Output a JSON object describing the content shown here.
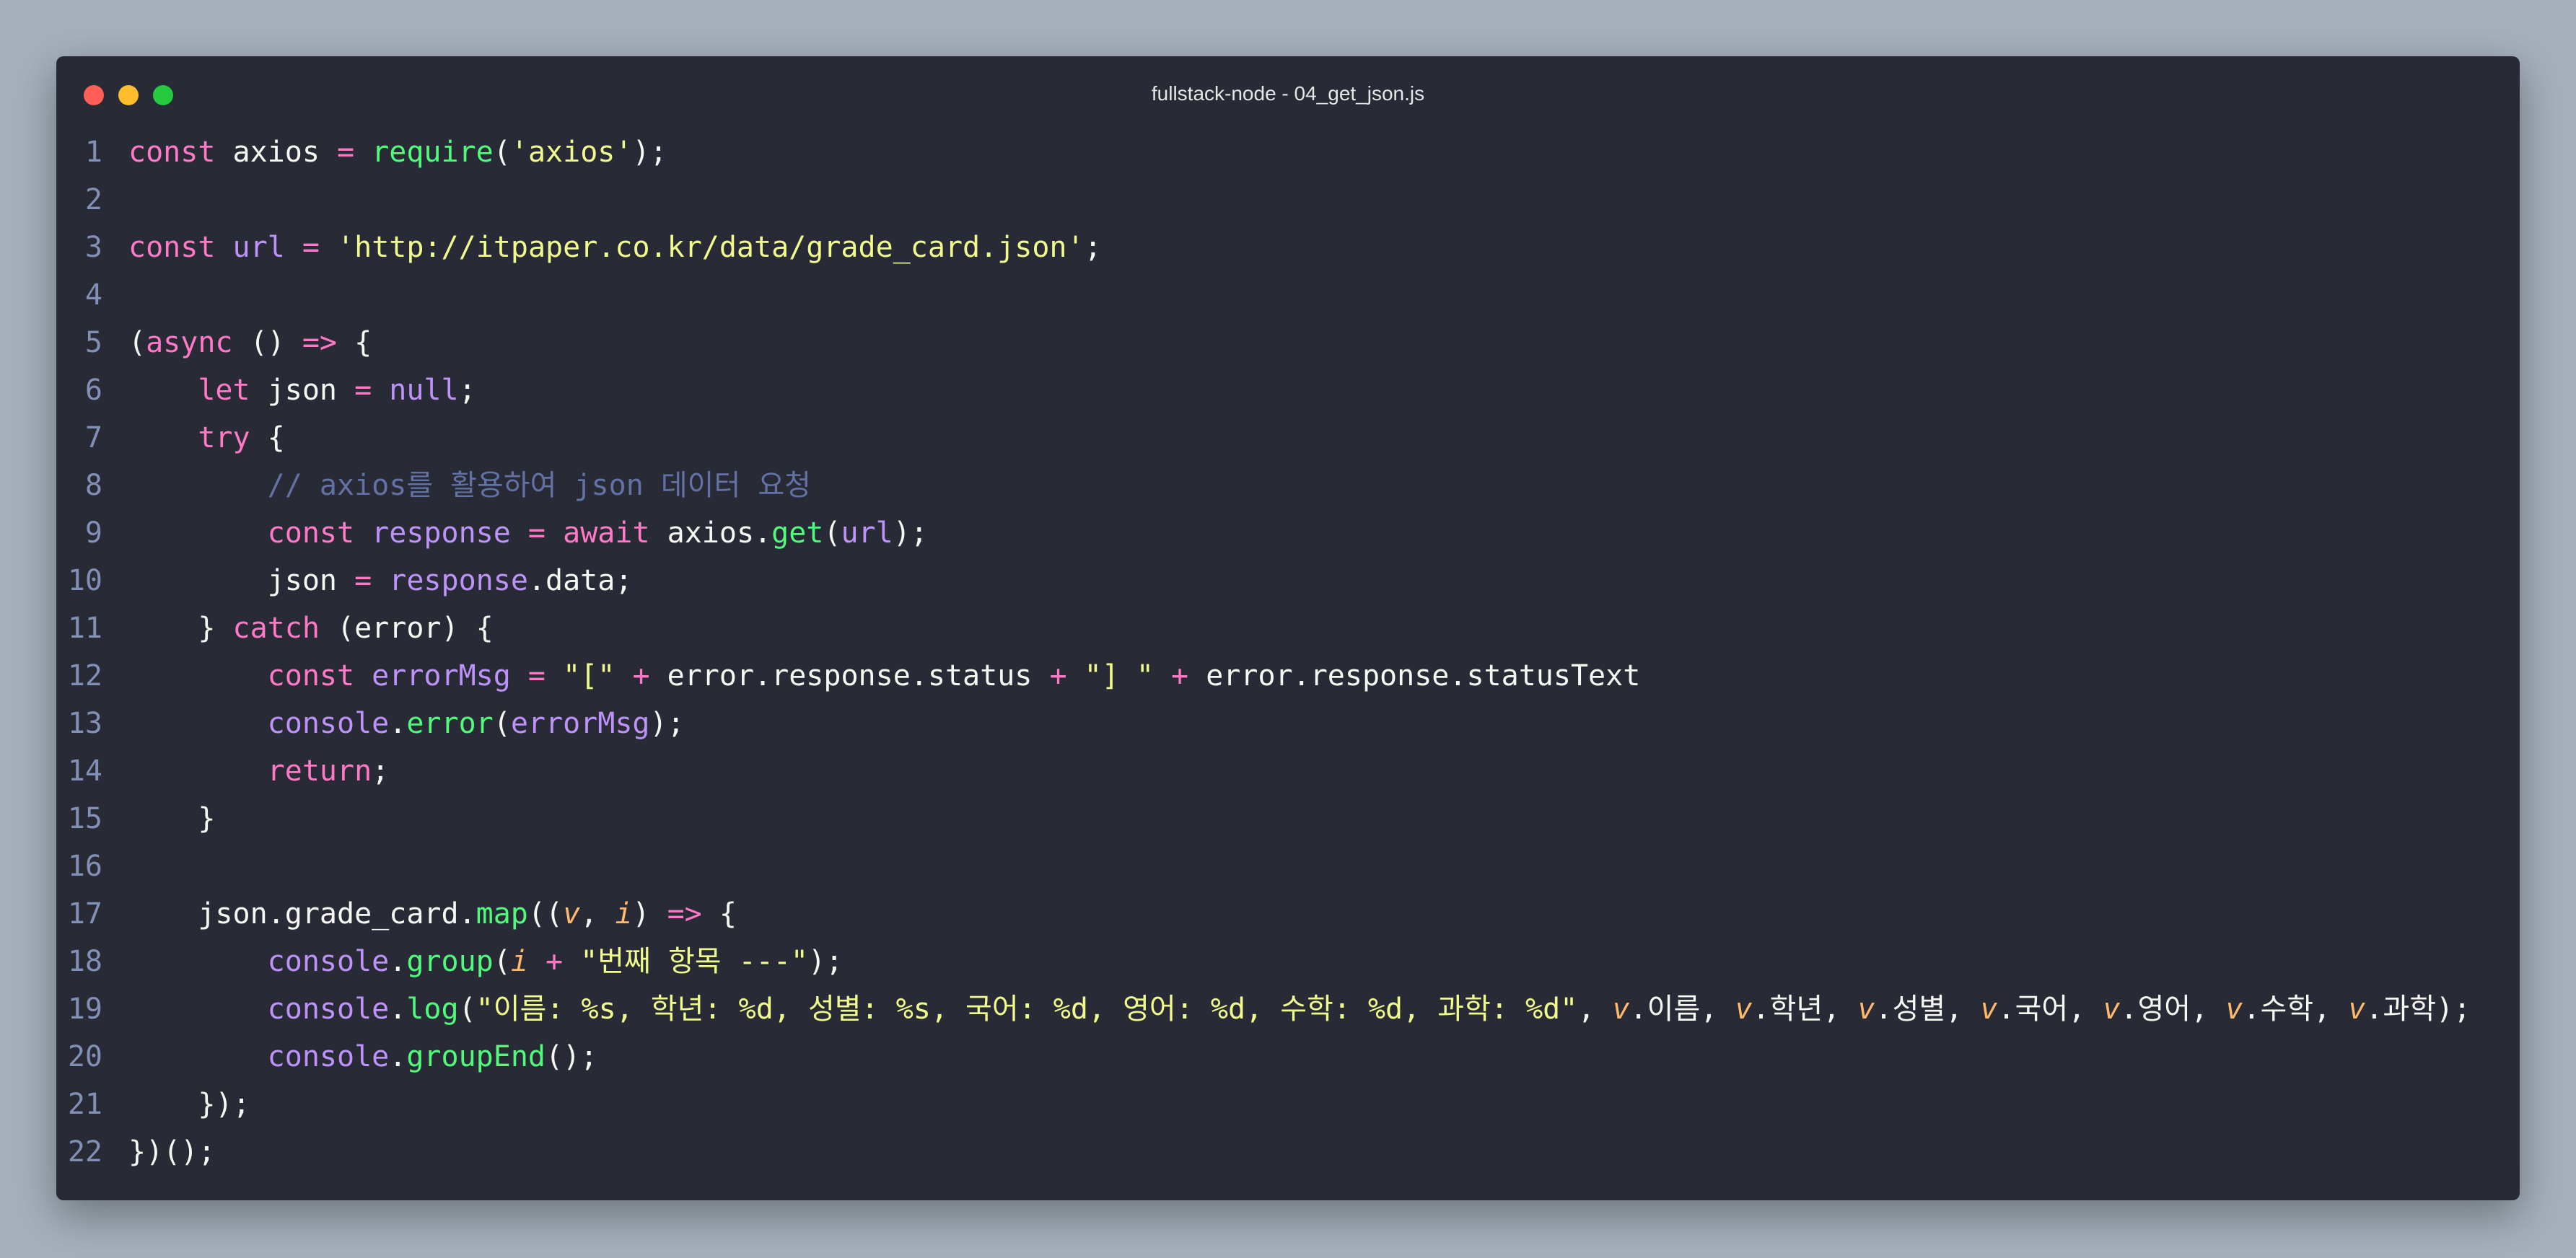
{
  "window": {
    "title": "fullstack-node - 04_get_json.js"
  },
  "lines": [
    {
      "n": "1",
      "tokens": [
        {
          "t": "const",
          "c": "k"
        },
        {
          "t": " axios ",
          "c": "p"
        },
        {
          "t": "=",
          "c": "k"
        },
        {
          "t": " ",
          "c": "p"
        },
        {
          "t": "require",
          "c": "f"
        },
        {
          "t": "(",
          "c": "p"
        },
        {
          "t": "'axios'",
          "c": "s"
        },
        {
          "t": ");",
          "c": "p"
        }
      ]
    },
    {
      "n": "2",
      "tokens": []
    },
    {
      "n": "3",
      "tokens": [
        {
          "t": "const",
          "c": "k"
        },
        {
          "t": " ",
          "c": "p"
        },
        {
          "t": "url",
          "c": "d"
        },
        {
          "t": " ",
          "c": "p"
        },
        {
          "t": "=",
          "c": "k"
        },
        {
          "t": " ",
          "c": "p"
        },
        {
          "t": "'http://itpaper.co.kr/data/grade_card.json'",
          "c": "s"
        },
        {
          "t": ";",
          "c": "p"
        }
      ]
    },
    {
      "n": "4",
      "tokens": []
    },
    {
      "n": "5",
      "tokens": [
        {
          "t": "(",
          "c": "p"
        },
        {
          "t": "async",
          "c": "k"
        },
        {
          "t": " () ",
          "c": "p"
        },
        {
          "t": "=>",
          "c": "k"
        },
        {
          "t": " {",
          "c": "p"
        }
      ]
    },
    {
      "n": "6",
      "tokens": [
        {
          "t": "    ",
          "c": "p"
        },
        {
          "t": "let",
          "c": "k"
        },
        {
          "t": " json ",
          "c": "p"
        },
        {
          "t": "=",
          "c": "k"
        },
        {
          "t": " ",
          "c": "p"
        },
        {
          "t": "null",
          "c": "d"
        },
        {
          "t": ";",
          "c": "p"
        }
      ]
    },
    {
      "n": "7",
      "tokens": [
        {
          "t": "    ",
          "c": "p"
        },
        {
          "t": "try",
          "c": "k"
        },
        {
          "t": " {",
          "c": "p"
        }
      ]
    },
    {
      "n": "8",
      "tokens": [
        {
          "t": "        ",
          "c": "p"
        },
        {
          "t": "// axios를 활용하여 json 데이터 요청",
          "c": "c"
        }
      ]
    },
    {
      "n": "9",
      "tokens": [
        {
          "t": "        ",
          "c": "p"
        },
        {
          "t": "const",
          "c": "k"
        },
        {
          "t": " ",
          "c": "p"
        },
        {
          "t": "response",
          "c": "d"
        },
        {
          "t": " ",
          "c": "p"
        },
        {
          "t": "=",
          "c": "k"
        },
        {
          "t": " ",
          "c": "p"
        },
        {
          "t": "await",
          "c": "k"
        },
        {
          "t": " axios.",
          "c": "p"
        },
        {
          "t": "get",
          "c": "f"
        },
        {
          "t": "(",
          "c": "p"
        },
        {
          "t": "url",
          "c": "d"
        },
        {
          "t": ");",
          "c": "p"
        }
      ]
    },
    {
      "n": "10",
      "tokens": [
        {
          "t": "        json ",
          "c": "p"
        },
        {
          "t": "=",
          "c": "k"
        },
        {
          "t": " ",
          "c": "p"
        },
        {
          "t": "response",
          "c": "d"
        },
        {
          "t": ".data;",
          "c": "p"
        }
      ]
    },
    {
      "n": "11",
      "tokens": [
        {
          "t": "    } ",
          "c": "p"
        },
        {
          "t": "catch",
          "c": "k"
        },
        {
          "t": " (error) {",
          "c": "p"
        }
      ]
    },
    {
      "n": "12",
      "tokens": [
        {
          "t": "        ",
          "c": "p"
        },
        {
          "t": "const",
          "c": "k"
        },
        {
          "t": " ",
          "c": "p"
        },
        {
          "t": "errorMsg",
          "c": "d"
        },
        {
          "t": " ",
          "c": "p"
        },
        {
          "t": "=",
          "c": "k"
        },
        {
          "t": " ",
          "c": "p"
        },
        {
          "t": "\"[\"",
          "c": "s"
        },
        {
          "t": " ",
          "c": "p"
        },
        {
          "t": "+",
          "c": "k"
        },
        {
          "t": " error.response.status ",
          "c": "p"
        },
        {
          "t": "+",
          "c": "k"
        },
        {
          "t": " ",
          "c": "p"
        },
        {
          "t": "\"] \"",
          "c": "s"
        },
        {
          "t": " ",
          "c": "p"
        },
        {
          "t": "+",
          "c": "k"
        },
        {
          "t": " error.response.statusText",
          "c": "p"
        }
      ]
    },
    {
      "n": "13",
      "tokens": [
        {
          "t": "        ",
          "c": "p"
        },
        {
          "t": "console",
          "c": "d"
        },
        {
          "t": ".",
          "c": "p"
        },
        {
          "t": "error",
          "c": "f"
        },
        {
          "t": "(",
          "c": "p"
        },
        {
          "t": "errorMsg",
          "c": "d"
        },
        {
          "t": ");",
          "c": "p"
        }
      ]
    },
    {
      "n": "14",
      "tokens": [
        {
          "t": "        ",
          "c": "p"
        },
        {
          "t": "return",
          "c": "k"
        },
        {
          "t": ";",
          "c": "p"
        }
      ]
    },
    {
      "n": "15",
      "tokens": [
        {
          "t": "    }",
          "c": "p"
        }
      ]
    },
    {
      "n": "16",
      "tokens": []
    },
    {
      "n": "17",
      "tokens": [
        {
          "t": "    json.grade_card.",
          "c": "p"
        },
        {
          "t": "map",
          "c": "f"
        },
        {
          "t": "((",
          "c": "p"
        },
        {
          "t": "v",
          "c": "v"
        },
        {
          "t": ", ",
          "c": "p"
        },
        {
          "t": "i",
          "c": "v"
        },
        {
          "t": ") ",
          "c": "p"
        },
        {
          "t": "=>",
          "c": "k"
        },
        {
          "t": " {",
          "c": "p"
        }
      ]
    },
    {
      "n": "18",
      "tokens": [
        {
          "t": "        ",
          "c": "p"
        },
        {
          "t": "console",
          "c": "d"
        },
        {
          "t": ".",
          "c": "p"
        },
        {
          "t": "group",
          "c": "f"
        },
        {
          "t": "(",
          "c": "p"
        },
        {
          "t": "i",
          "c": "v"
        },
        {
          "t": " ",
          "c": "p"
        },
        {
          "t": "+",
          "c": "k"
        },
        {
          "t": " ",
          "c": "p"
        },
        {
          "t": "\"번째 항목 ---\"",
          "c": "s"
        },
        {
          "t": ");",
          "c": "p"
        }
      ]
    },
    {
      "n": "19",
      "tokens": [
        {
          "t": "        ",
          "c": "p"
        },
        {
          "t": "console",
          "c": "d"
        },
        {
          "t": ".",
          "c": "p"
        },
        {
          "t": "log",
          "c": "f"
        },
        {
          "t": "(",
          "c": "p"
        },
        {
          "t": "\"이름: %s, 학년: %d, 성별: %s, 국어: %d, 영어: %d, 수학: %d, 과학: %d\"",
          "c": "s"
        },
        {
          "t": ", ",
          "c": "p"
        },
        {
          "t": "v",
          "c": "v"
        },
        {
          "t": ".이름, ",
          "c": "p"
        },
        {
          "t": "v",
          "c": "v"
        },
        {
          "t": ".학년, ",
          "c": "p"
        },
        {
          "t": "v",
          "c": "v"
        },
        {
          "t": ".성별, ",
          "c": "p"
        },
        {
          "t": "v",
          "c": "v"
        },
        {
          "t": ".국어, ",
          "c": "p"
        },
        {
          "t": "v",
          "c": "v"
        },
        {
          "t": ".영어, ",
          "c": "p"
        },
        {
          "t": "v",
          "c": "v"
        },
        {
          "t": ".수학, ",
          "c": "p"
        },
        {
          "t": "v",
          "c": "v"
        },
        {
          "t": ".과학);",
          "c": "p"
        }
      ]
    },
    {
      "n": "20",
      "tokens": [
        {
          "t": "        ",
          "c": "p"
        },
        {
          "t": "console",
          "c": "d"
        },
        {
          "t": ".",
          "c": "p"
        },
        {
          "t": "groupEnd",
          "c": "f"
        },
        {
          "t": "();",
          "c": "p"
        }
      ]
    },
    {
      "n": "21",
      "tokens": [
        {
          "t": "    });",
          "c": "p"
        }
      ]
    },
    {
      "n": "22",
      "tokens": [
        {
          "t": "})();",
          "c": "p"
        }
      ]
    }
  ]
}
